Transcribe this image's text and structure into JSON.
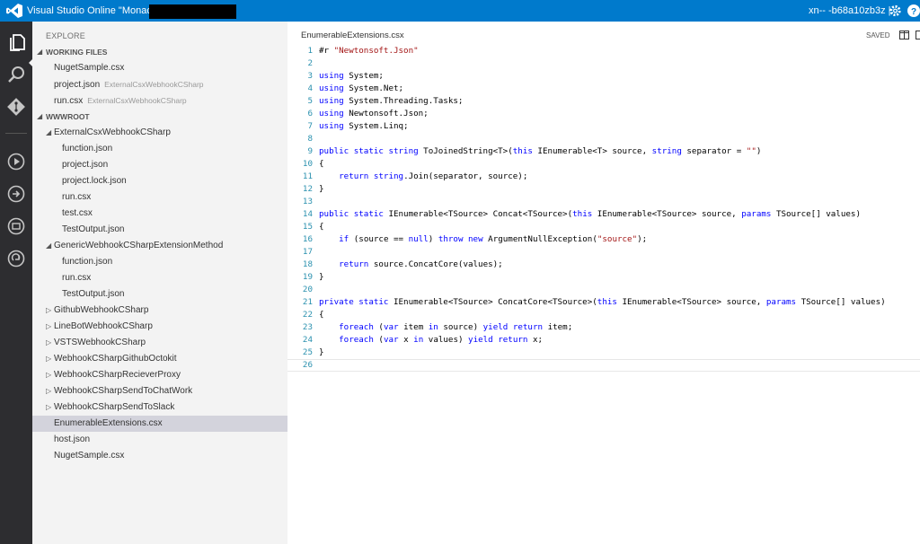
{
  "titlebar": {
    "app_title": "Visual Studio Online \"Monaco\"",
    "account": "xn-- -b68a10zb3z  |",
    "colors": {
      "accent": "#007acc"
    }
  },
  "activity_bar": {
    "icons": [
      "files-icon",
      "search-icon",
      "git-icon",
      "run-icon",
      "output-icon",
      "console-icon",
      "deploy-icon"
    ]
  },
  "sidebar": {
    "title": "EXPLORE",
    "working_files_header": "WORKING FILES",
    "working_files": [
      {
        "name": "NugetSample.csx",
        "dir": ""
      },
      {
        "name": "project.json",
        "dir": "ExternalCsxWebhookCSharp"
      },
      {
        "name": "run.csx",
        "dir": "ExternalCsxWebhookCSharp"
      }
    ],
    "wwwroot_header": "WWWROOT",
    "tree": [
      {
        "name": "ExternalCsxWebhookCSharp",
        "kind": "folder-open",
        "depth": 1
      },
      {
        "name": "function.json",
        "kind": "file",
        "depth": 2
      },
      {
        "name": "project.json",
        "kind": "file",
        "depth": 2
      },
      {
        "name": "project.lock.json",
        "kind": "file",
        "depth": 2
      },
      {
        "name": "run.csx",
        "kind": "file",
        "depth": 2
      },
      {
        "name": "test.csx",
        "kind": "file",
        "depth": 2
      },
      {
        "name": "TestOutput.json",
        "kind": "file",
        "depth": 2
      },
      {
        "name": "GenericWebhookCSharpExtensionMethod",
        "kind": "folder-open",
        "depth": 1
      },
      {
        "name": "function.json",
        "kind": "file",
        "depth": 2
      },
      {
        "name": "run.csx",
        "kind": "file",
        "depth": 2
      },
      {
        "name": "TestOutput.json",
        "kind": "file",
        "depth": 2
      },
      {
        "name": "GithubWebhookCSharp",
        "kind": "folder-closed",
        "depth": 1
      },
      {
        "name": "LineBotWebhookCSharp",
        "kind": "folder-closed",
        "depth": 1
      },
      {
        "name": "VSTSWebhookCSharp",
        "kind": "folder-closed",
        "depth": 1
      },
      {
        "name": "WebhookCSharpGithubOctokit",
        "kind": "folder-closed",
        "depth": 1
      },
      {
        "name": "WebhookCSharpRecieverProxy",
        "kind": "folder-closed",
        "depth": 1
      },
      {
        "name": "WebhookCSharpSendToChatWork",
        "kind": "folder-closed",
        "depth": 1
      },
      {
        "name": "WebhookCSharpSendToSlack",
        "kind": "folder-closed",
        "depth": 1
      },
      {
        "name": "EnumerableExtensions.csx",
        "kind": "file",
        "depth": 1,
        "selected": true
      },
      {
        "name": "host.json",
        "kind": "file",
        "depth": 1
      },
      {
        "name": "NugetSample.csx",
        "kind": "file",
        "depth": 1
      }
    ]
  },
  "editor": {
    "filename": "EnumerableExtensions.csx",
    "status": "SAVED",
    "active_line": 26,
    "lines": [
      [
        [
          "t",
          "#r "
        ],
        [
          "s",
          "\"Newtonsoft.Json\""
        ]
      ],
      [],
      [
        [
          "k",
          "using"
        ],
        [
          "t",
          " System;"
        ]
      ],
      [
        [
          "k",
          "using"
        ],
        [
          "t",
          " System.Net;"
        ]
      ],
      [
        [
          "k",
          "using"
        ],
        [
          "t",
          " System.Threading.Tasks;"
        ]
      ],
      [
        [
          "k",
          "using"
        ],
        [
          "t",
          " Newtonsoft.Json;"
        ]
      ],
      [
        [
          "k",
          "using"
        ],
        [
          "t",
          " System.Linq;"
        ]
      ],
      [],
      [
        [
          "k",
          "public static string"
        ],
        [
          "t",
          " ToJoinedString<T>("
        ],
        [
          "k",
          "this"
        ],
        [
          "t",
          " IEnumerable<T> source, "
        ],
        [
          "k",
          "string"
        ],
        [
          "t",
          " separator = "
        ],
        [
          "s",
          "\"\""
        ],
        [
          "t",
          ")"
        ]
      ],
      [
        [
          "t",
          "{"
        ]
      ],
      [
        [
          "t",
          "    "
        ],
        [
          "k",
          "return string"
        ],
        [
          "t",
          ".Join(separator, source);"
        ]
      ],
      [
        [
          "t",
          "}"
        ]
      ],
      [],
      [
        [
          "k",
          "public static"
        ],
        [
          "t",
          " IEnumerable<TSource> Concat<TSource>("
        ],
        [
          "k",
          "this"
        ],
        [
          "t",
          " IEnumerable<TSource> source, "
        ],
        [
          "k",
          "params"
        ],
        [
          "t",
          " TSource[] values)"
        ]
      ],
      [
        [
          "t",
          "{"
        ]
      ],
      [
        [
          "t",
          "    "
        ],
        [
          "k",
          "if"
        ],
        [
          "t",
          " (source == "
        ],
        [
          "k",
          "null"
        ],
        [
          "t",
          ") "
        ],
        [
          "k",
          "throw new"
        ],
        [
          "t",
          " ArgumentNullException("
        ],
        [
          "s",
          "\"source\""
        ],
        [
          "t",
          ");"
        ]
      ],
      [],
      [
        [
          "t",
          "    "
        ],
        [
          "k",
          "return"
        ],
        [
          "t",
          " source.ConcatCore(values);"
        ]
      ],
      [
        [
          "t",
          "}"
        ]
      ],
      [],
      [
        [
          "k",
          "private static"
        ],
        [
          "t",
          " IEnumerable<TSource> ConcatCore<TSource>("
        ],
        [
          "k",
          "this"
        ],
        [
          "t",
          " IEnumerable<TSource> source, "
        ],
        [
          "k",
          "params"
        ],
        [
          "t",
          " TSource[] values)"
        ]
      ],
      [
        [
          "t",
          "{"
        ]
      ],
      [
        [
          "t",
          "    "
        ],
        [
          "k",
          "foreach"
        ],
        [
          "t",
          " ("
        ],
        [
          "k",
          "var"
        ],
        [
          "t",
          " item "
        ],
        [
          "k",
          "in"
        ],
        [
          "t",
          " source) "
        ],
        [
          "k",
          "yield return"
        ],
        [
          "t",
          " item;"
        ]
      ],
      [
        [
          "t",
          "    "
        ],
        [
          "k",
          "foreach"
        ],
        [
          "t",
          " ("
        ],
        [
          "k",
          "var"
        ],
        [
          "t",
          " x "
        ],
        [
          "k",
          "in"
        ],
        [
          "t",
          " values) "
        ],
        [
          "k",
          "yield return"
        ],
        [
          "t",
          " x;"
        ]
      ],
      [
        [
          "t",
          "}"
        ]
      ],
      []
    ]
  }
}
